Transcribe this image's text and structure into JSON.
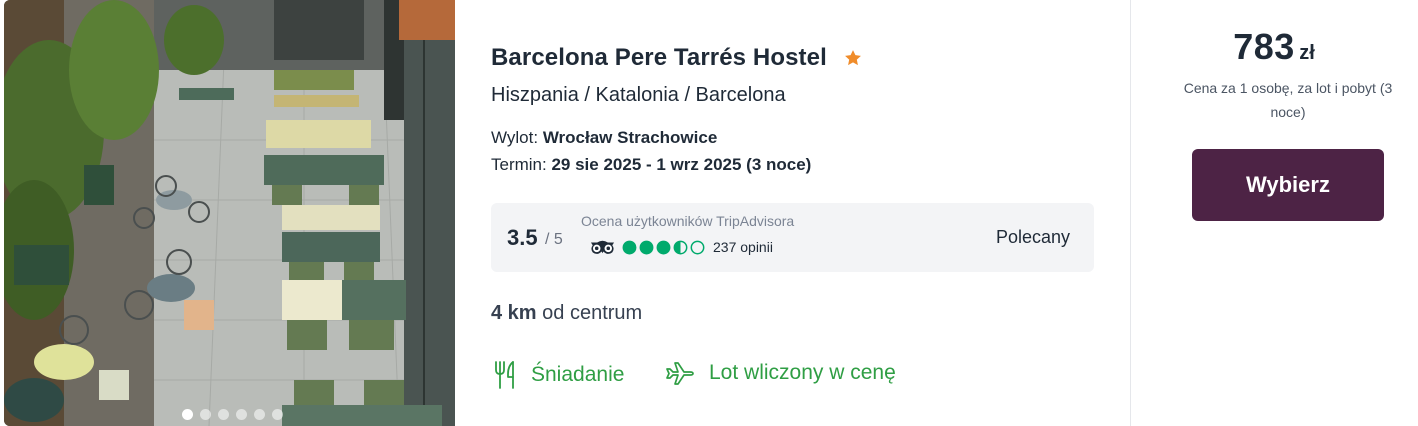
{
  "hotel": {
    "name": "Barcelona Pere Tarrés Hostel",
    "stars": 1,
    "location": "Hiszpania / Katalonia / Barcelona"
  },
  "flight": {
    "departure_label": "Wylot:",
    "departure_value": "Wrocław Strachowice",
    "dates_label": "Termin:",
    "dates_value": "29 sie 2025 - 1 wrz 2025 (3 noce)"
  },
  "rating": {
    "score": "3.5",
    "max": "/ 5",
    "source_label": "Ocena użytkowników TripAdvisora",
    "bubbles_filled": 3.5,
    "bubbles_total": 5,
    "reviews": "237 opinii",
    "verdict": "Polecany"
  },
  "distance": {
    "value": "4 km",
    "label": "od centrum"
  },
  "features": [
    {
      "label": "Śniadanie",
      "icon": "cutlery-icon"
    },
    {
      "label": "Lot wliczony w cenę",
      "icon": "airplane-icon"
    }
  ],
  "price": {
    "amount": "783",
    "currency": "zł",
    "note": "Cena za 1 osobę, za lot i pobyt (3 noce)"
  },
  "actions": {
    "select_label": "Wybierz"
  },
  "gallery": {
    "slides": 6,
    "active": 0
  },
  "colors": {
    "accent_button": "#4d2345",
    "feature_green": "#2f9e44",
    "tripadvisor_green": "#00aa6c",
    "star_orange": "#f08c2a",
    "rating_bg": "#f3f4f6"
  }
}
